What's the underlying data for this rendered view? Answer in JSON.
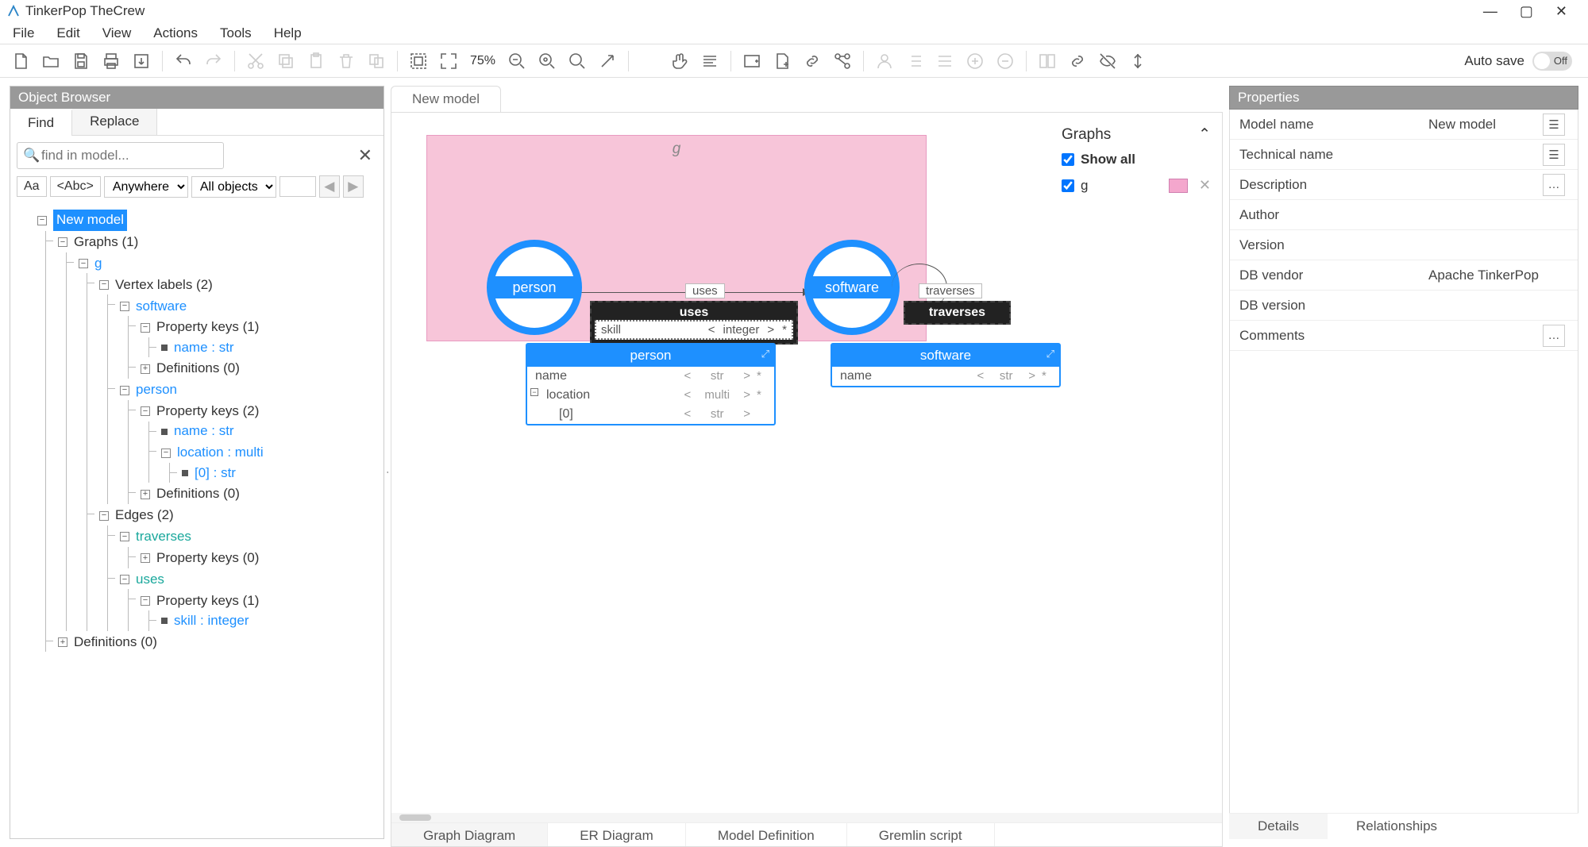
{
  "titlebar": {
    "title": "TinkerPop TheCrew"
  },
  "menubar": [
    "File",
    "Edit",
    "View",
    "Actions",
    "Tools",
    "Help"
  ],
  "toolbar": {
    "zoom": "75%",
    "autosave_label": "Auto save",
    "autosave_state": "Off"
  },
  "left": {
    "panel_title": "Object Browser",
    "tabs": {
      "find": "Find",
      "replace": "Replace"
    },
    "search_placeholder": "find in model...",
    "filters": {
      "aa": "Aa",
      "abc": "<Abc>",
      "where": "Anywhere",
      "what": "All objects"
    },
    "tree": {
      "root": "New model",
      "graphs": "Graphs (1)",
      "g": "g",
      "vlabels": "Vertex labels (2)",
      "software": "software",
      "software_pk": "Property keys (1)",
      "software_name": "name : str",
      "software_defs": "Definitions (0)",
      "person": "person",
      "person_pk": "Property keys (2)",
      "person_name": "name : str",
      "person_loc": "location : multi",
      "person_loc_0": "[0] : str",
      "person_defs": "Definitions (0)",
      "edges": "Edges (2)",
      "traverses": "traverses",
      "traverses_pk": "Property keys (0)",
      "uses": "uses",
      "uses_pk": "Property keys (1)",
      "uses_skill": "skill : integer",
      "defs": "Definitions (0)"
    }
  },
  "center": {
    "tab": "New model",
    "graph_box": "g",
    "person": "person",
    "software": "software",
    "uses_label": "uses",
    "uses_edge": "uses",
    "traverses_label": "traverses",
    "traverses_edge": "traverses",
    "skill_row": {
      "name": "skill",
      "lt": "<",
      "type": "integer",
      "gt": ">",
      "star": "*"
    },
    "person_entity": {
      "title": "person",
      "rows": [
        {
          "name": "name",
          "lt": "<",
          "type": "str",
          "gt": ">",
          "star": "*"
        },
        {
          "name": "location",
          "lt": "<",
          "type": "multi",
          "gt": ">",
          "star": "*"
        },
        {
          "name": "[0]",
          "lt": "<",
          "type": "str",
          "gt": ">",
          "star": ""
        }
      ]
    },
    "software_entity": {
      "title": "software",
      "rows": [
        {
          "name": "name",
          "lt": "<",
          "type": "str",
          "gt": ">",
          "star": "*"
        }
      ]
    },
    "graphs_panel": {
      "title": "Graphs",
      "show_all": "Show all",
      "g": "g"
    },
    "view_tabs": [
      "Graph Diagram",
      "ER Diagram",
      "Model Definition",
      "Gremlin script"
    ]
  },
  "right": {
    "panel_title": "Properties",
    "rows": {
      "model_name": {
        "label": "Model name",
        "value": "New model"
      },
      "tech_name": {
        "label": "Technical name",
        "value": ""
      },
      "description": {
        "label": "Description",
        "value": ""
      },
      "author": {
        "label": "Author",
        "value": ""
      },
      "version": {
        "label": "Version",
        "value": ""
      },
      "db_vendor": {
        "label": "DB vendor",
        "value": "Apache TinkerPop"
      },
      "db_version": {
        "label": "DB version",
        "value": ""
      },
      "comments": {
        "label": "Comments",
        "value": ""
      }
    },
    "tabs": [
      "Details",
      "Relationships"
    ]
  }
}
